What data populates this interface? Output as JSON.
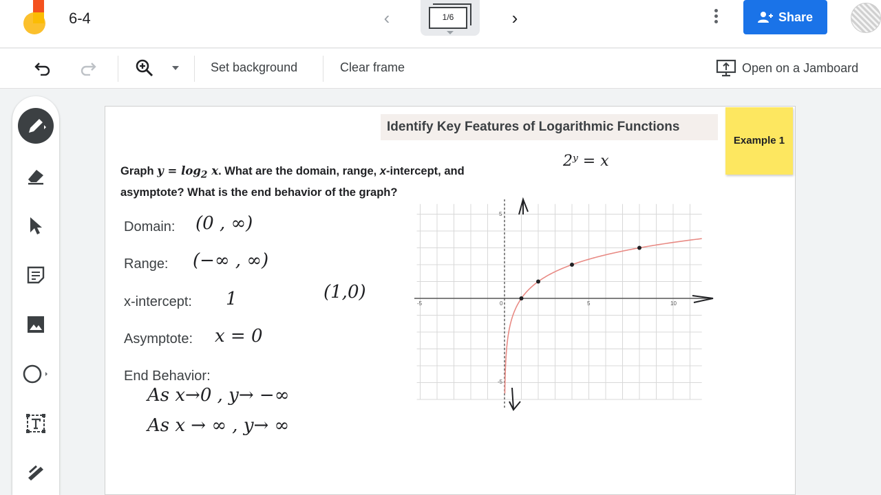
{
  "app": {
    "title": "6-4",
    "frame_indicator": "1/6",
    "share_label": "Share"
  },
  "toolbar": {
    "set_background": "Set background",
    "clear_frame": "Clear frame",
    "open_jamboard": "Open on a Jamboard"
  },
  "tools": [
    "pen-icon",
    "eraser-icon",
    "select-icon",
    "sticky-note-icon",
    "image-icon",
    "circle-icon",
    "text-box-icon",
    "laser-icon"
  ],
  "slide": {
    "heading": "Identify Key Features of Logarithmic Functions",
    "sticky": "Example 1",
    "question_line1_a": "Graph ",
    "question_eq": "y = log",
    "question_sub": "2",
    "question_x": " x",
    "question_line1_b": ". What are the domain, range, ",
    "question_xi": "x",
    "question_line1_c": "-intercept, and",
    "question_line2": "asymptote? What is the end behavior of the graph?",
    "labels": {
      "domain": "Domain:",
      "range": "Range:",
      "x_intercept": "x-intercept:",
      "asymptote": "Asymptote:",
      "end_behavior": "End Behavior:"
    },
    "handwriting": {
      "top_note": "2ʸ = x",
      "domain": "(0 , ∞)",
      "range": "(−∞ , ∞)",
      "x_intercept": "1",
      "point": "(1,0)",
      "asymptote": "x = 0",
      "end1": "As  x→0 ,  y→ −∞",
      "end2": "As  x → ∞ ,  y→ ∞"
    },
    "graph": {
      "tick_labels": [
        "-5",
        "0",
        "5",
        "10"
      ],
      "y_tick_labels": [
        "5",
        "-5"
      ],
      "curve_color": "#e88a84",
      "points": [
        [
          1,
          0
        ],
        [
          2,
          1
        ],
        [
          4,
          2
        ],
        [
          8,
          3
        ]
      ]
    }
  }
}
